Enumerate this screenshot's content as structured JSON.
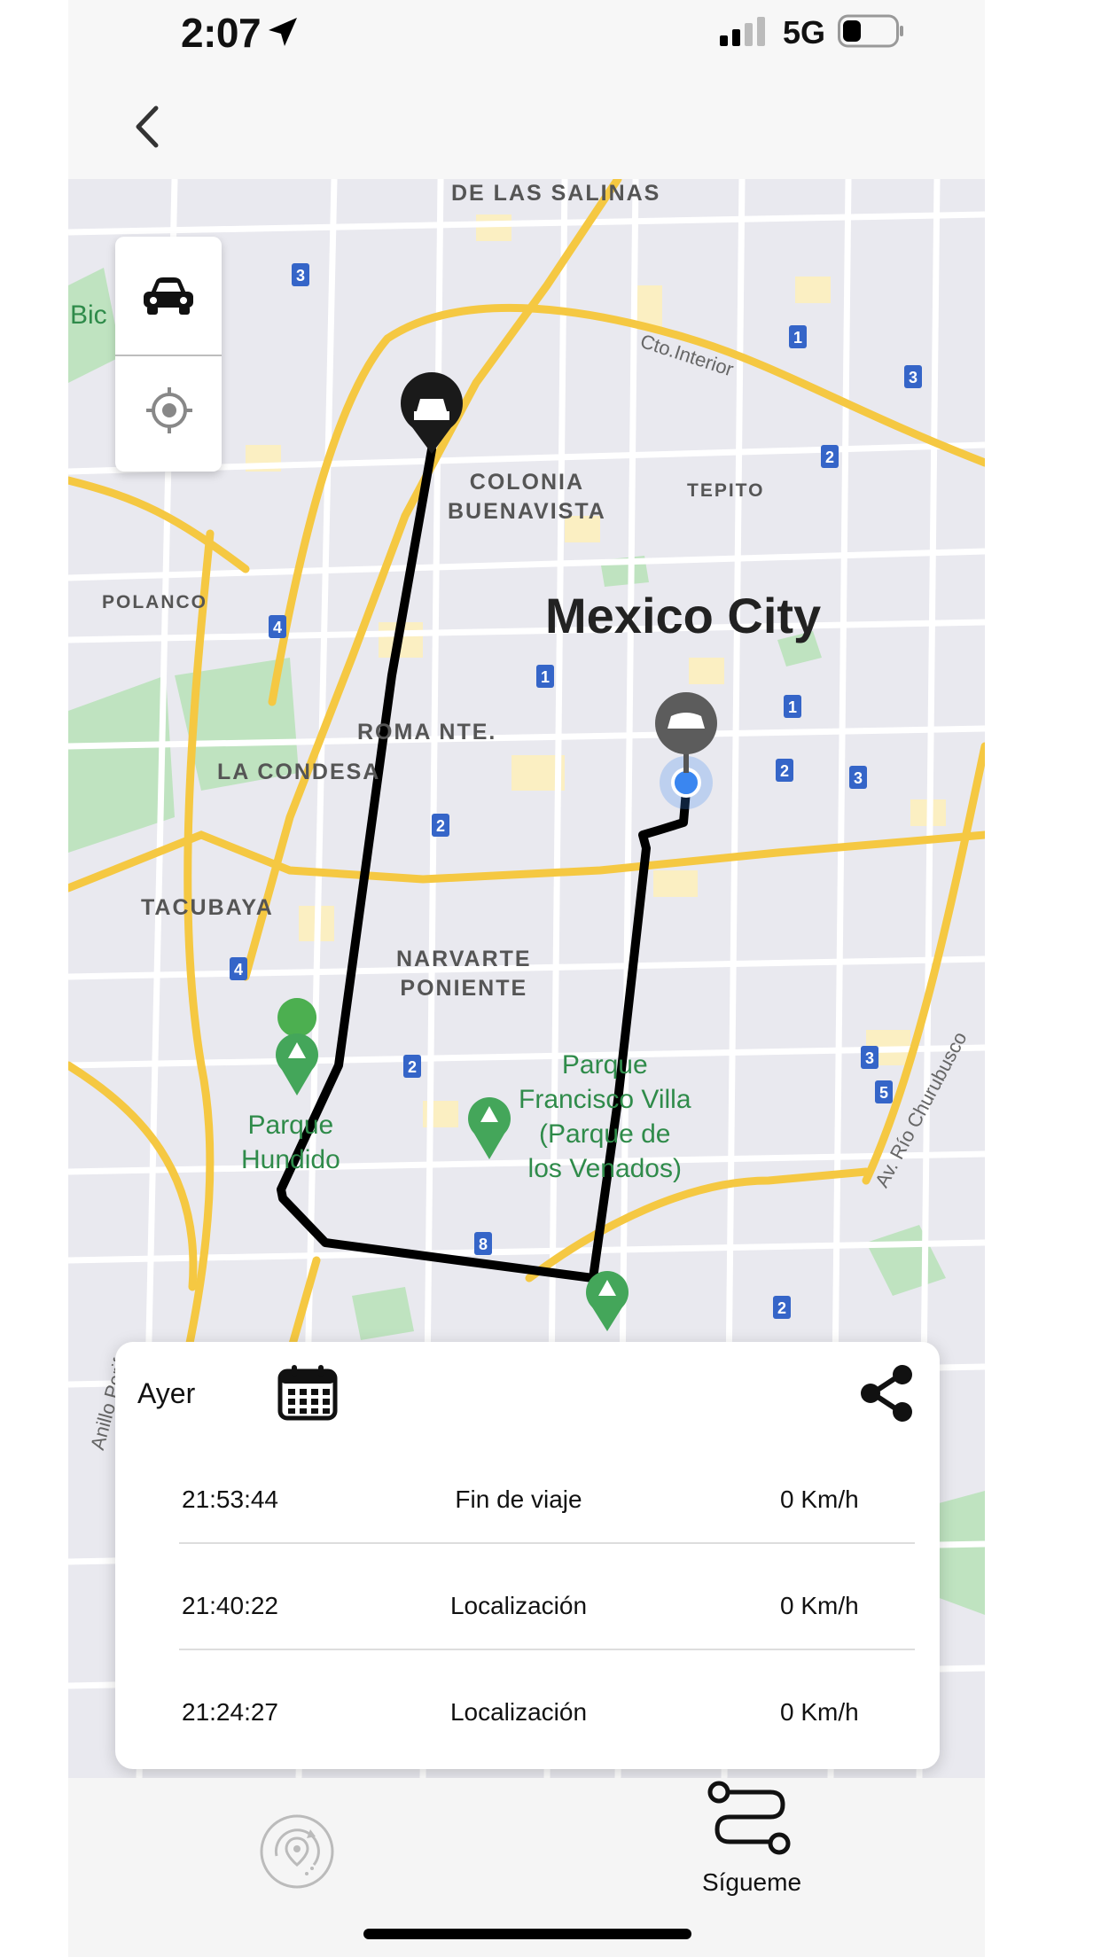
{
  "status_bar": {
    "time": "2:07",
    "network": "5G"
  },
  "map": {
    "labels": {
      "salinas": "DE LAS SALINAS",
      "cto": "Cto.Interior",
      "colonia": "COLONIA\nBUENAVISTA",
      "tepito": "TEPITO",
      "polanco": "POLANCO",
      "mexico": "Mexico City",
      "roma": "ROMA NTE.",
      "condesa": "LA CONDESA",
      "tacubaya": "TACUBAYA",
      "narvarte": "NARVARTE\nPONIENTE",
      "parque_villa": "Parque\nFrancisco Villa\n(Parque de\nlos Venados)",
      "parque_hundido": "Parque\nHundido",
      "rio": "Av. Río Churubusco",
      "anillo": "Anillo Perif",
      "bic": "Bic"
    }
  },
  "trip": {
    "day_label": "Ayer",
    "rows": [
      {
        "time": "21:53:44",
        "event": "Fin de viaje",
        "speed": "0 Km/h"
      },
      {
        "time": "21:40:22",
        "event": "Localización",
        "speed": "0 Km/h"
      },
      {
        "time": "21:24:27",
        "event": "Localización",
        "speed": "0 Km/h"
      }
    ]
  },
  "bottom_nav": {
    "follow_label": "Sígueme"
  },
  "colors": {
    "route": "#000000",
    "road_major": "#f5c842",
    "park": "#bfe3c0",
    "map_bg": "#e9e9ef",
    "accent_blue": "#3a86f0"
  }
}
